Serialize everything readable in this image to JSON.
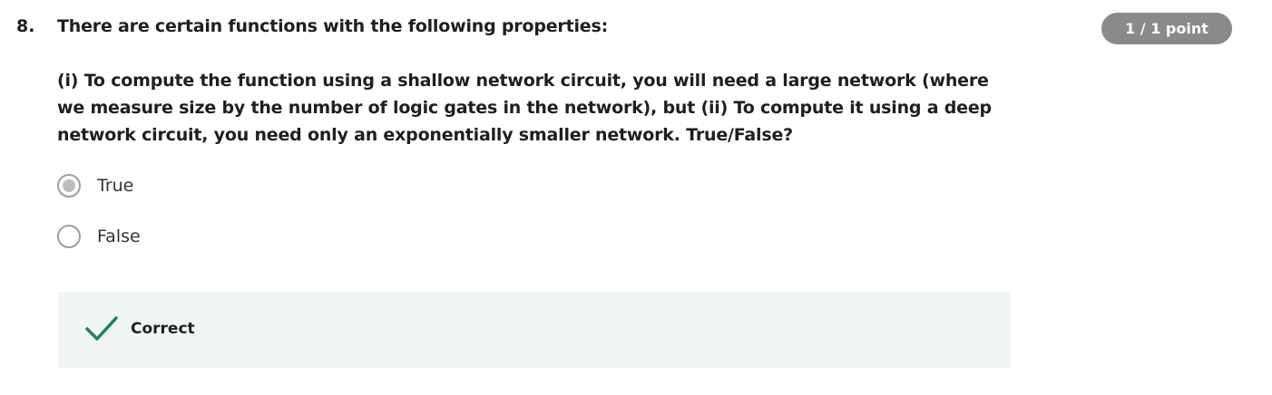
{
  "question": {
    "number": "8.",
    "title": "There are certain functions with the following properties:",
    "body": "(i) To compute the function using a shallow network circuit, you will need a large network (where we measure size by the number of logic gates in the network), but (ii) To compute it using a deep network circuit, you need only an exponentially smaller network. True/False?",
    "points": "1 / 1 point"
  },
  "options": [
    {
      "label": "True",
      "selected": true
    },
    {
      "label": "False",
      "selected": false
    }
  ],
  "feedback": {
    "status": "Correct",
    "icon": "checkmark-icon",
    "color": "#1f8354",
    "background": "#f1f6f4"
  },
  "colors": {
    "badge_background": "#8a8a8a",
    "text": "#1f1f1f"
  }
}
